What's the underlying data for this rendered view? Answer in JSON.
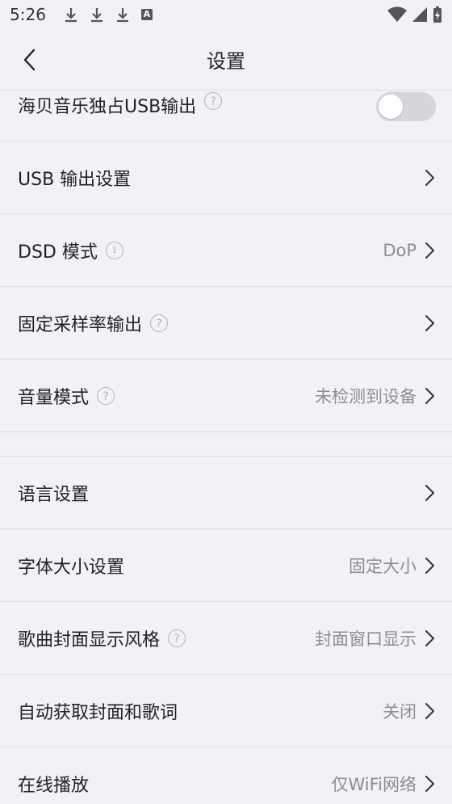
{
  "status_bar": {
    "time": "5:26",
    "icons_left": [
      "download-icon",
      "download-icon",
      "download-icon",
      "font-a-icon"
    ],
    "icons_right": [
      "wifi-icon",
      "signal-icon",
      "battery-charging-icon"
    ],
    "a_glyph": "A"
  },
  "header": {
    "title": "设置",
    "back_icon": "chevron-left-icon"
  },
  "settings": {
    "exclusive_usb": {
      "label": "海贝音乐独占USB输出",
      "enabled": false
    },
    "usb_output": {
      "label": "USB 输出设置"
    },
    "dsd_mode": {
      "label": "DSD 模式",
      "value": "DoP"
    },
    "fixed_sample_rate": {
      "label": "固定采样率输出"
    },
    "volume_mode": {
      "label": "音量模式",
      "value": "未检测到设备"
    },
    "language": {
      "label": "语言设置"
    },
    "font_size": {
      "label": "字体大小设置",
      "value": "固定大小"
    },
    "cover_style": {
      "label": "歌曲封面显示风格",
      "value": "封面窗口显示"
    },
    "auto_fetch": {
      "label": "自动获取封面和歌词",
      "value": "关闭"
    },
    "online_play": {
      "label": "在线播放",
      "value": "仅WiFi网络"
    }
  },
  "icons": {
    "help": "?",
    "info": "i"
  },
  "colors": {
    "background": "#f2f1f6",
    "text": "#222222",
    "secondary_text": "#8e8e92",
    "toggle_off": "#d6d5da"
  }
}
